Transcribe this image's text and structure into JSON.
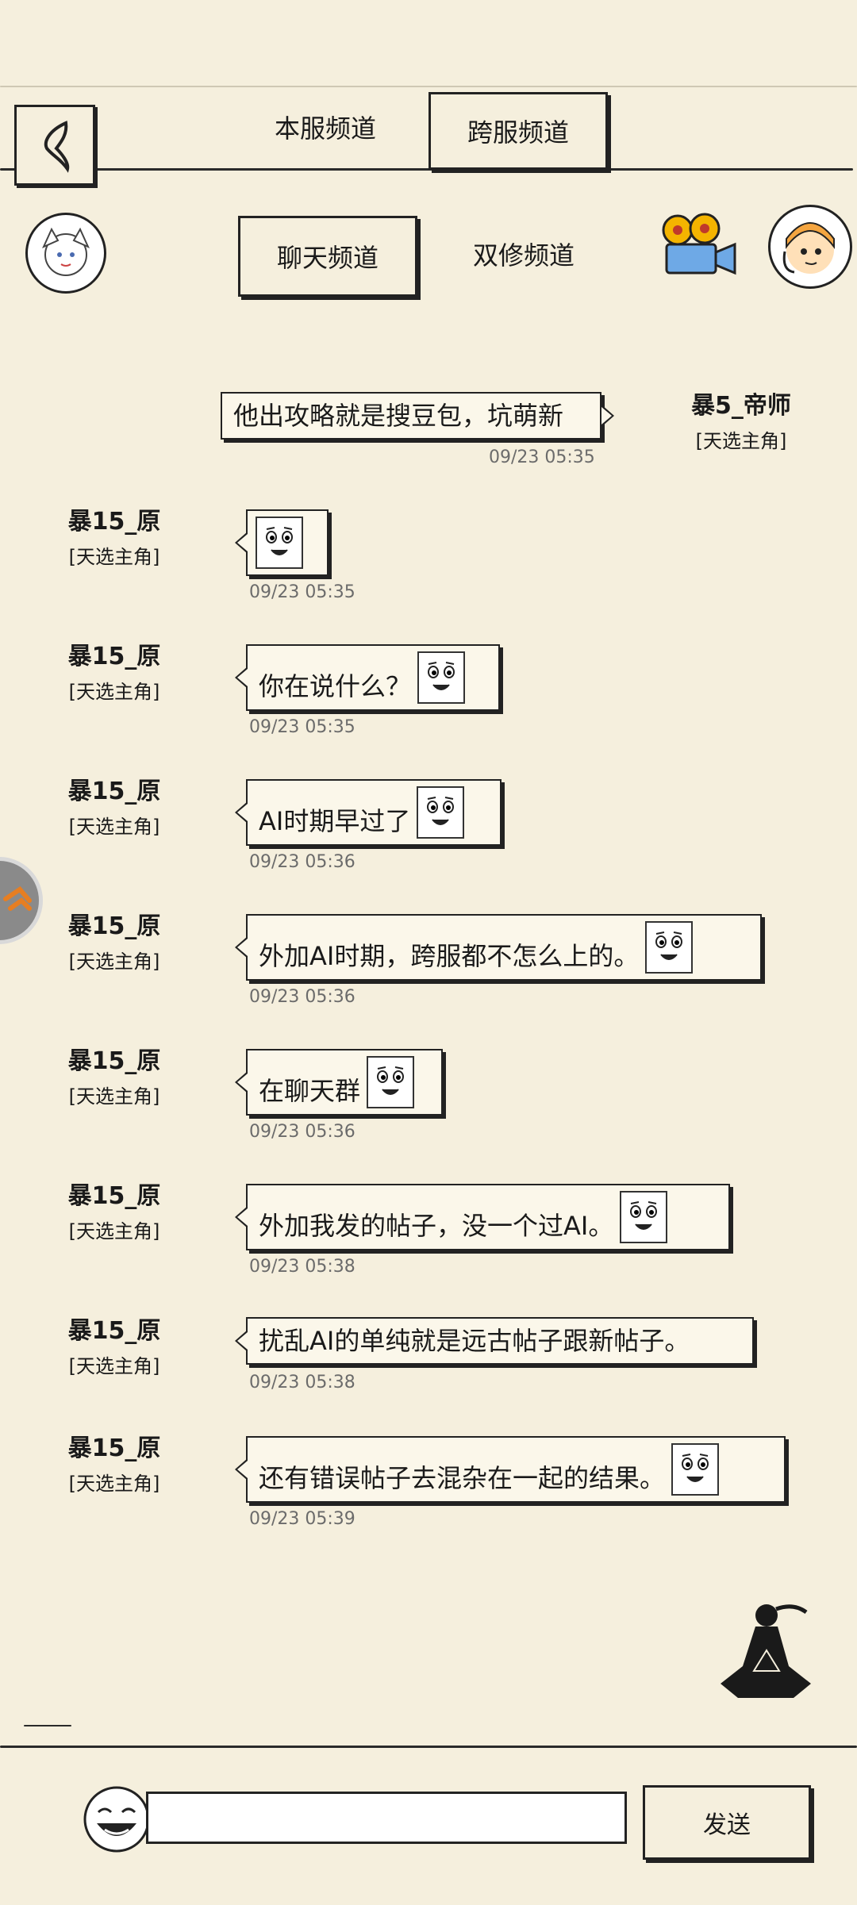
{
  "header": {
    "tabs_top": [
      {
        "label": "本服频道",
        "active": false
      },
      {
        "label": "跨服频道",
        "active": true
      }
    ],
    "tabs_sub": [
      {
        "label": "聊天频道",
        "active": true
      },
      {
        "label": "双修频道",
        "active": false
      }
    ]
  },
  "self_message": {
    "sender": "暴5_帝师",
    "title": "[天选主角]",
    "text": "他出攻略就是搜豆包，坑萌新",
    "time": "09/23 05:35"
  },
  "messages": [
    {
      "sender": "暴15_原",
      "title": "[天选主角]",
      "text": "",
      "emoji": true,
      "time": "09/23 05:35"
    },
    {
      "sender": "暴15_原",
      "title": "[天选主角]",
      "text": "你在说什么？",
      "emoji": true,
      "time": "09/23 05:35"
    },
    {
      "sender": "暴15_原",
      "title": "[天选主角]",
      "text": "AI时期早过了",
      "emoji": true,
      "time": "09/23 05:36"
    },
    {
      "sender": "暴15_原",
      "title": "[天选主角]",
      "text": "外加AI时期，跨服都不怎么上的。",
      "emoji": true,
      "time": "09/23 05:36"
    },
    {
      "sender": "暴15_原",
      "title": "[天选主角]",
      "text": "在聊天群",
      "emoji": true,
      "time": "09/23 05:36"
    },
    {
      "sender": "暴15_原",
      "title": "[天选主角]",
      "text": "外加我发的帖子，没一个过AI。",
      "emoji": true,
      "time": "09/23 05:38"
    },
    {
      "sender": "暴15_原",
      "title": "[天选主角]",
      "text": "扰乱AI的单纯就是远古帖子跟新帖子。",
      "emoji": false,
      "time": "09/23 05:38"
    },
    {
      "sender": "暴15_原",
      "title": "[天选主角]",
      "text": "还有错误帖子去混杂在一起的结果。",
      "emoji": true,
      "time": "09/23 05:39"
    }
  ],
  "bottom": {
    "input_value": "",
    "send_label": "发送"
  },
  "icons": {
    "back": "back-arrow-icon",
    "avatar": "user-avatar-icon",
    "camera": "video-camera-icon",
    "service": "customer-service-avatar-icon",
    "float": "floating-assistant-icon",
    "meditate": "meditation-figure-icon",
    "emoji_btn": "emoji-face-icon"
  }
}
